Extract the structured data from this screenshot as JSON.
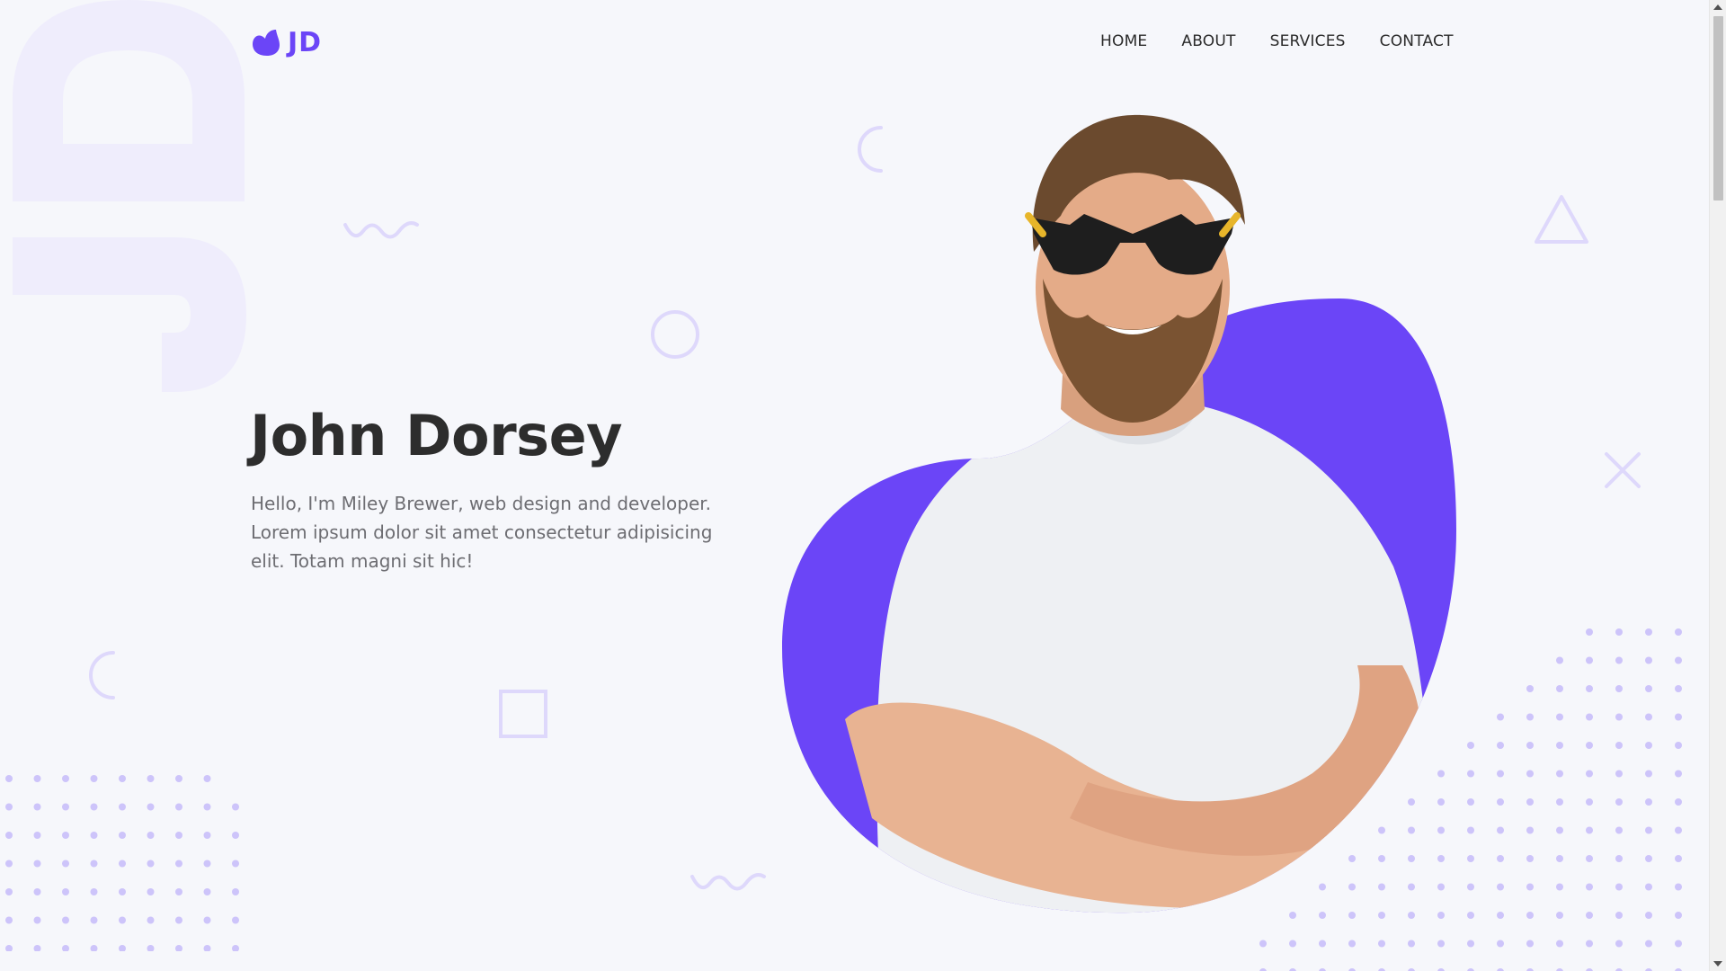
{
  "brand": {
    "logo_text": "JD",
    "accent_color": "#6b45f7",
    "icon": "blob-heart-icon"
  },
  "nav": {
    "items": [
      {
        "label": "HOME"
      },
      {
        "label": "ABOUT"
      },
      {
        "label": "SERVICES"
      },
      {
        "label": "CONTACT"
      }
    ]
  },
  "hero": {
    "title": "John Dorsey",
    "description": "Hello, I'm Miley Brewer, web design and developer. Lorem ipsum dolor sit amet consectetur adipisicing elit. Totam magni sit hic!",
    "portrait_icon": "person-portrait"
  },
  "background": {
    "monogram": "JD",
    "shapes": [
      "arc-icon",
      "wave-icon",
      "circle-icon",
      "triangle-icon",
      "cross-icon",
      "square-icon",
      "dot-grid"
    ]
  },
  "colors": {
    "background": "#f6f7fb",
    "text_dark": "#2d2d2d",
    "text_muted": "#6d6d72",
    "decor_light": "#ded8fb",
    "dots": "#cdc4fa"
  }
}
